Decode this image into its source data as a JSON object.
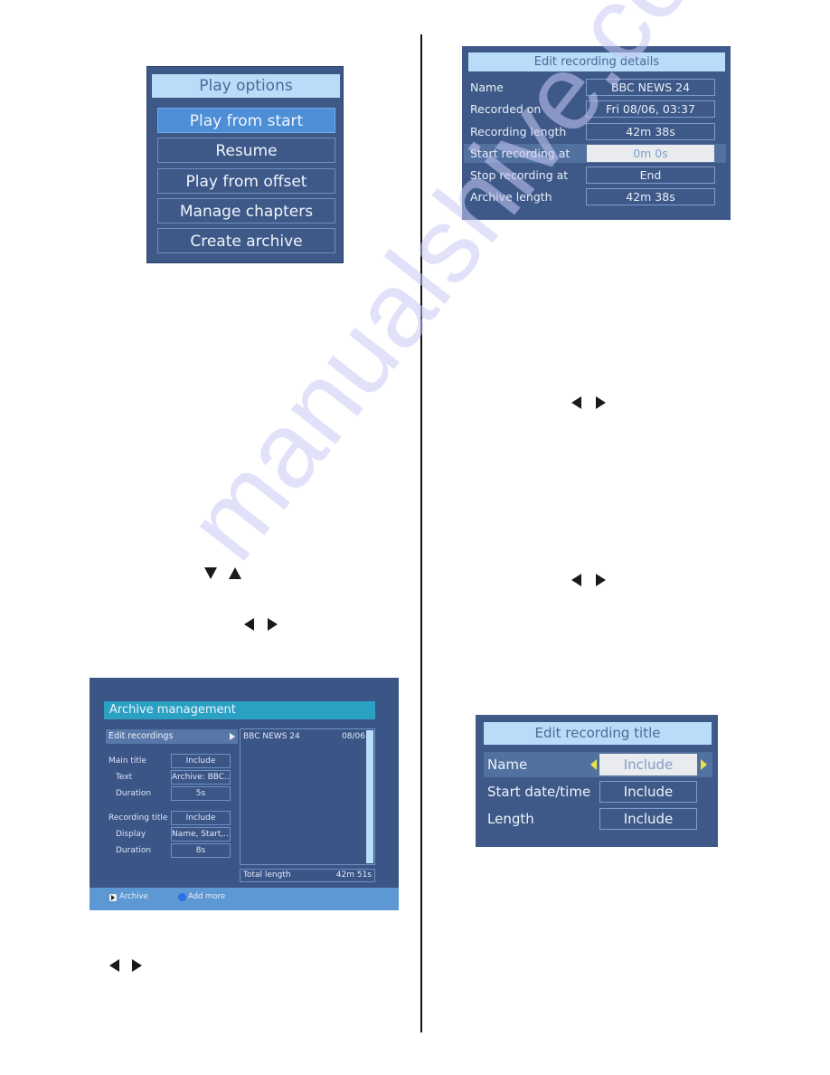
{
  "watermark": "manualshive.com",
  "play_options": {
    "title": "Play options",
    "items": [
      {
        "label": "Play from start",
        "selected": true
      },
      {
        "label": "Resume",
        "selected": false
      },
      {
        "label": "Play from offset",
        "selected": false
      },
      {
        "label": "Manage chapters",
        "selected": false
      },
      {
        "label": "Create archive",
        "selected": false
      }
    ]
  },
  "edit_recording_details": {
    "title": "Edit recording details",
    "rows": [
      {
        "label": "Name",
        "value": "BBC NEWS 24",
        "selected": false
      },
      {
        "label": "Recorded on",
        "value": "Fri 08/06, 03:37",
        "selected": false
      },
      {
        "label": "Recording length",
        "value": "42m 38s",
        "selected": false
      },
      {
        "label": "Start recording at",
        "value": "0m 0s",
        "selected": true
      },
      {
        "label": "Stop recording at",
        "value": "End",
        "selected": false
      },
      {
        "label": "Archive length",
        "value": "42m 38s",
        "selected": false
      }
    ]
  },
  "archive_management": {
    "title": "Archive management",
    "edit_recordings_label": "Edit recordings",
    "main_title": {
      "label": "Main title",
      "value": "Include"
    },
    "text": {
      "label": "Text",
      "value": "Archive: BBC..."
    },
    "main_duration": {
      "label": "Duration",
      "value": "5s"
    },
    "recording_title": {
      "label": "Recording title",
      "value": "Include"
    },
    "display": {
      "label": "Display",
      "value": "Name, Start,..."
    },
    "recording_duration": {
      "label": "Duration",
      "value": "8s"
    },
    "list": [
      {
        "name": "BBC NEWS 24",
        "date": "08/06"
      }
    ],
    "total_length_label": "Total length",
    "total_length_value": "42m 51s",
    "footer": {
      "archive_label": "Archive",
      "add_more_label": "Add more"
    }
  },
  "edit_recording_title": {
    "title": "Edit recording title",
    "rows": [
      {
        "label": "Name",
        "value": "Include",
        "selected": true
      },
      {
        "label": "Start date/time",
        "value": "Include",
        "selected": false
      },
      {
        "label": "Length",
        "value": "Include",
        "selected": false
      }
    ]
  },
  "nav_glyphs": {
    "down": "arrow-down",
    "up": "arrow-up",
    "left": "arrow-left",
    "right": "arrow-right"
  }
}
